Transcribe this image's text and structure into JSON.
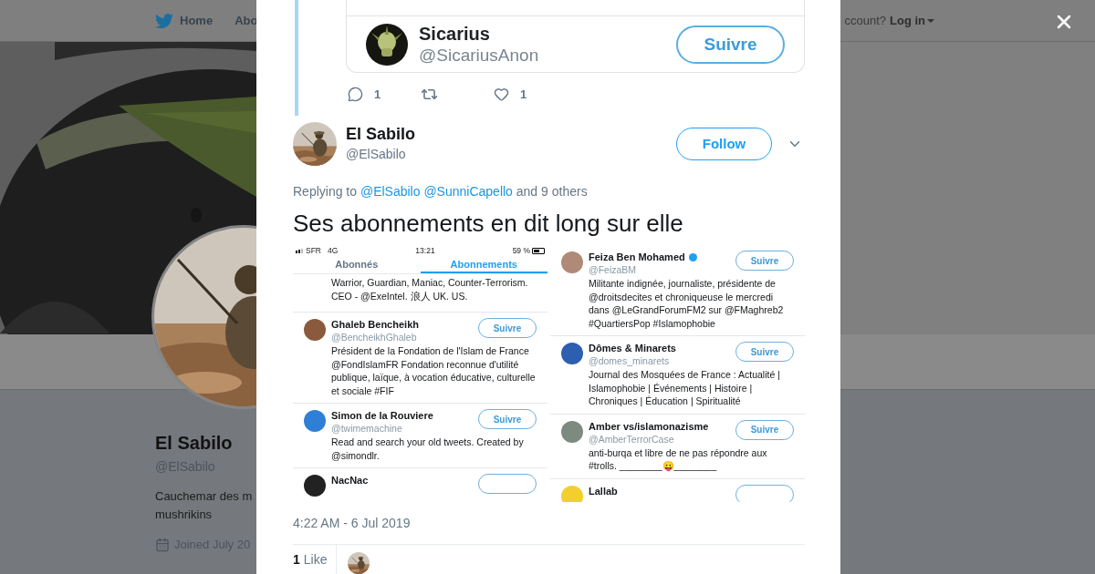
{
  "page_header": {
    "nav": [
      {
        "kind": "home",
        "label": "Home"
      },
      {
        "kind": "plain",
        "label": "Abo"
      }
    ],
    "login_prompt": "ccount?",
    "login": "Log in"
  },
  "profile": {
    "name": "El Sabilo",
    "handle": "@ElSabilo",
    "bio_lines": [
      "Cauchemar des m",
      "mushrikins"
    ],
    "joined": "Joined July 20"
  },
  "modal": {
    "quoted_card": {
      "name": "Sicarius",
      "handle": "@SicariusAnon",
      "button": "Suivre"
    },
    "previous_actions": [
      {
        "kind": "reply",
        "count": "1"
      },
      {
        "kind": "retweet"
      },
      {
        "kind": "like",
        "count": "1"
      }
    ],
    "tweet": {
      "author": "El Sabilo",
      "handle": "@ElSabilo",
      "follow_button": "Follow",
      "replying": {
        "prefix": "Replying to",
        "mentions": [
          "@ElSabilo",
          "@SunniCapello"
        ],
        "suffix": "and 9 others"
      },
      "text": "Ses abonnements en dit long sur elle",
      "images": [
        {
          "status": {
            "carrier": "SFR",
            "network": "4G",
            "time": "13:21",
            "battery": "59 %"
          },
          "tabs": [
            {
              "label": "Abonnés",
              "selected": false
            },
            {
              "label": "Abonnements",
              "selected": true
            }
          ],
          "partial_bio": "Warrior, Guardian, Maniac, Counter-Terrorism. CEO - @ExeIntel. 浪人 UK. US.",
          "accounts": [
            {
              "name": "Ghaleb Bencheikh",
              "handle": "@BencheikhGhaleb",
              "button": "Suivre",
              "color": "#8a5a3c",
              "bio": "Président de la Fondation de l'Islam de France @FondIslamFR Fondation reconnue d'utilité publique, laïque, à vocation éducative, culturelle et sociale #FIF"
            },
            {
              "name": "Simon de la Rouviere",
              "handle": "@twimemachine",
              "button": "Suivre",
              "color": "#2f7fd6",
              "bio": "Read and search your old tweets. Created by @simondlr."
            },
            {
              "name": "NacNac",
              "color": "#222222"
            }
          ]
        },
        {
          "accounts": [
            {
              "name": "Feiza Ben Mohamed",
              "verified": true,
              "handle": "@FeizaBM",
              "button": "Suivre",
              "color": "#b08a78",
              "bio": "Militante indignée, journaliste, présidente de @droitsdecites et chroniqueuse le mercredi dans @LeGrandForumFM2 sur @FMaghreb2 #QuartiersPop #Islamophobie"
            },
            {
              "name": "Dômes & Minarets",
              "handle": "@domes_minarets",
              "button": "Suivre",
              "color": "#2d5fb0",
              "bio": "Journal des Mosquées de France : Actualité | Islamophobie | Événements | Histoire | Chroniques | Éducation | Spiritualité"
            },
            {
              "name": "Amber vs/islamonazisme",
              "handle": "@AmberTerrorCase",
              "button": "Suivre",
              "color": "#7d8a80",
              "bio": "anti-burqa et libre de ne pas répondre aux #trolls. ________😛________"
            },
            {
              "name": "Lallab",
              "color": "#f2cf2e"
            }
          ]
        }
      ],
      "timestamp": "4:22 AM - 6 Jul 2019",
      "likes": {
        "count": "1",
        "label": "Like"
      }
    }
  }
}
